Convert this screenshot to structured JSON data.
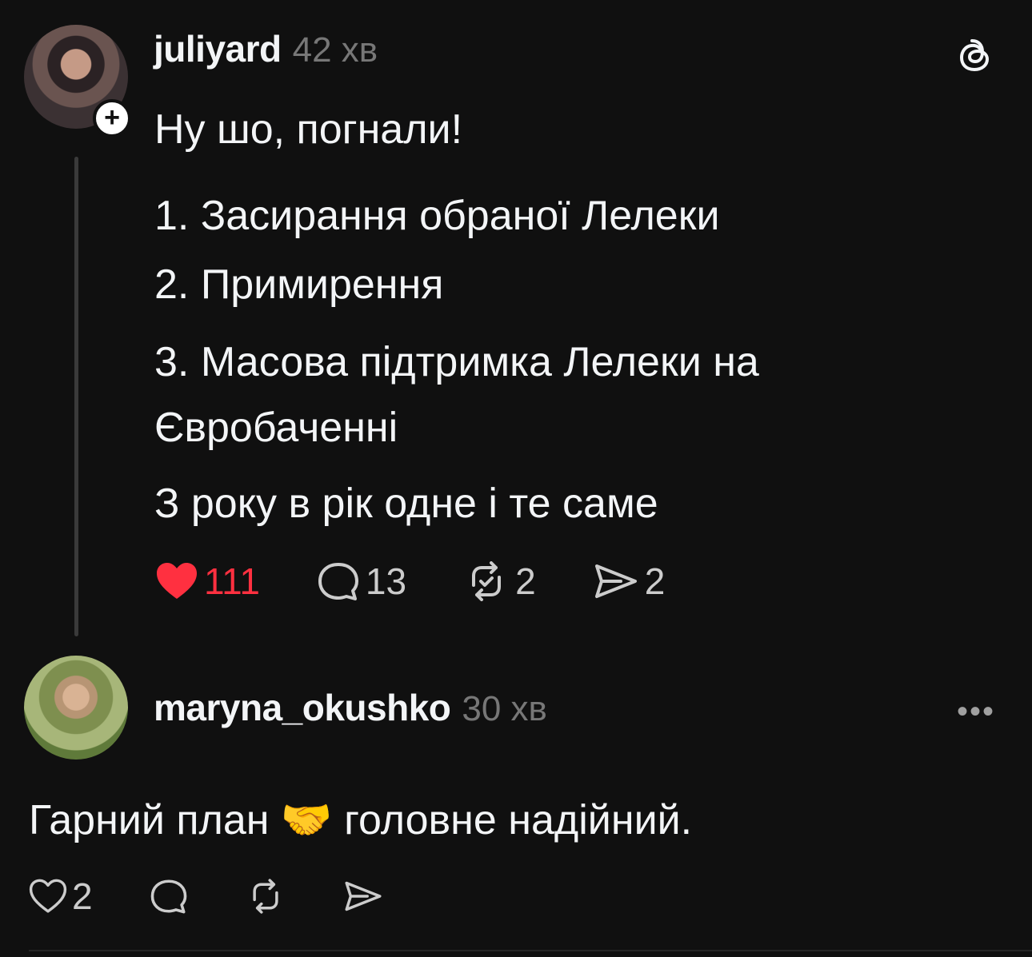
{
  "post": {
    "username": "juliyard",
    "time": "42 хв",
    "follow_symbol": "+",
    "intro": "Ну шо, погнали!",
    "list": [
      "1. Засирання обраної Лелеки",
      "2. Примирення",
      "3. Масова підтримка Лелеки на Євробаченні"
    ],
    "outro": "З року в рік одне і те саме",
    "likes": "111",
    "replies": "13",
    "reposts": "2",
    "shares": "2",
    "liked": true,
    "like_color": "#ff3040"
  },
  "reply": {
    "username": "maryna_okushko",
    "time": "30 хв",
    "text": "Гарний план 🤝 головне надійний.",
    "likes": "2",
    "more_symbol": "•••"
  },
  "icons": {
    "header_logo": "threads-logo-icon",
    "like": "heart-icon",
    "reply": "comment-icon",
    "repost": "repost-icon",
    "share": "send-icon",
    "more": "more-icon"
  }
}
